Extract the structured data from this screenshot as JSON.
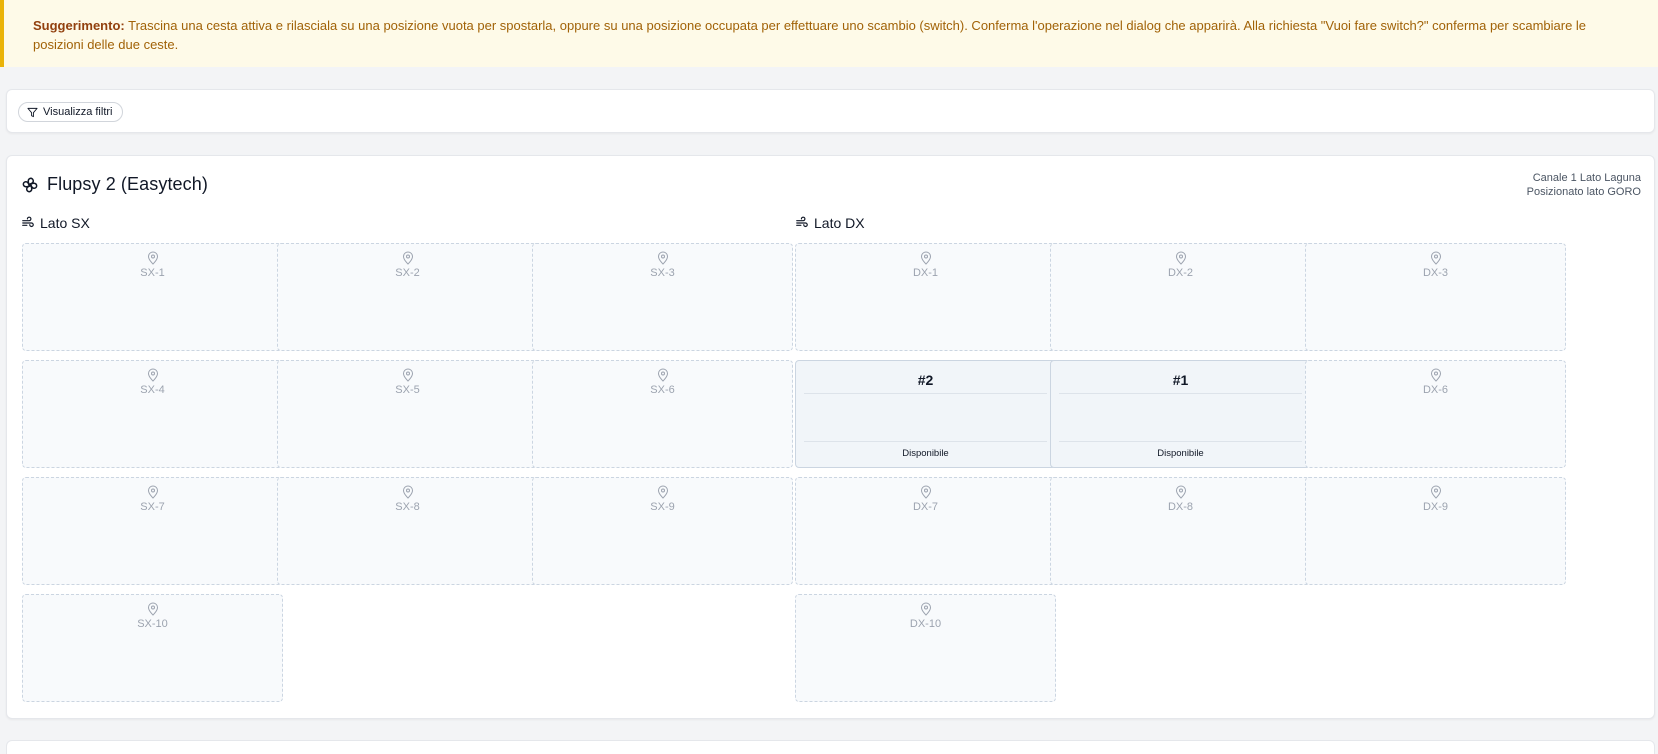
{
  "hint": {
    "label": "Suggerimento:",
    "text": "Trascina una cesta attiva e rilasciala su una posizione vuota per spostarla, oppure su una posizione occupata per effettuare uno scambio (switch). Conferma l'operazione nel dialog che apparirà. Alla richiesta \"Vuoi fare switch?\" conferma per scambiare le posizioni delle due ceste."
  },
  "filters": {
    "button_label": "Visualizza filtri",
    "icon": "filter-icon"
  },
  "flupsy": {
    "title": "Flupsy 2 (Easytech)",
    "icon": "fan-icon",
    "location": "Canale 1 Lato Laguna",
    "position_note": "Posizionato lato GORO"
  },
  "sides": {
    "sx": {
      "label": "Lato SX",
      "slots": [
        "SX-1",
        "SX-2",
        "SX-3",
        "SX-4",
        "SX-5",
        "SX-6",
        "SX-7",
        "SX-8",
        "SX-9",
        "SX-10"
      ]
    },
    "dx": {
      "label": "Lato DX",
      "slots": [
        "DX-1",
        "DX-2",
        "DX-3",
        "DX-6",
        "DX-7",
        "DX-8",
        "DX-9",
        "DX-10"
      ],
      "baskets": [
        {
          "number": "#2",
          "status": "Disponibile",
          "position": "DX-4"
        },
        {
          "number": "#1",
          "status": "Disponibile",
          "position": "DX-5"
        }
      ]
    }
  },
  "colors": {
    "hint_bg": "#fefae8",
    "hint_border": "#eab308",
    "hint_text": "#a16207",
    "slot_border": "#cbd5e1",
    "slot_bg": "#f8fafc",
    "basket_bg": "#f1f5f9"
  }
}
